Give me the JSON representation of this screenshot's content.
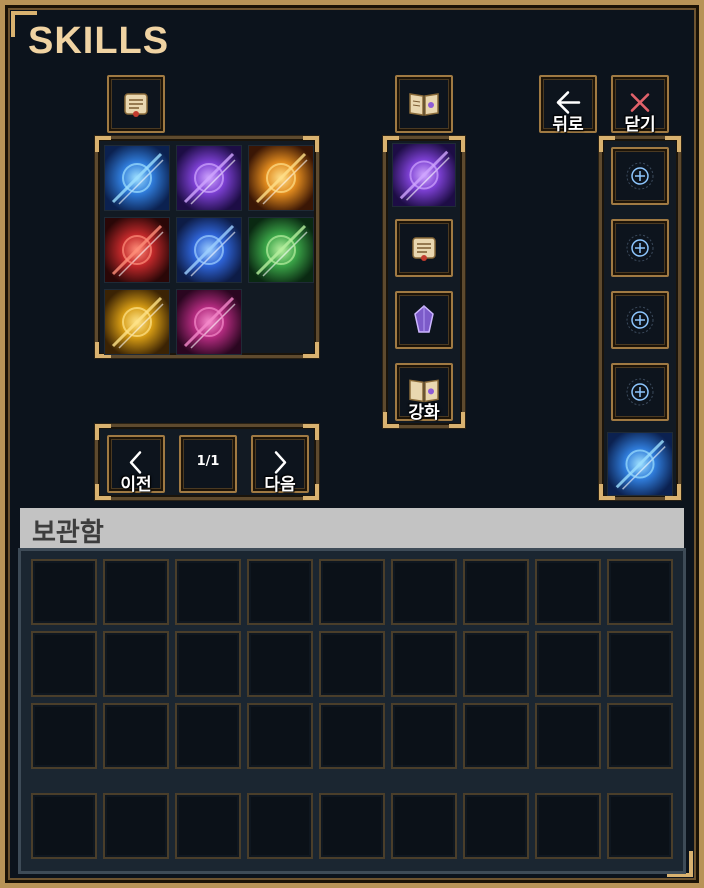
{
  "title": "SKILLS",
  "nav": {
    "back_label": "뒤로",
    "close_label": "닫기"
  },
  "enhance": {
    "enhance_label": "강화"
  },
  "pager": {
    "prev_label": "이전",
    "page_indicator": "1/1",
    "next_label": "다음"
  },
  "skills": [
    {
      "name": "blue-slash-skill-icon",
      "palette": [
        "#2f7bd9",
        "#9ee0ff",
        "#0b2150"
      ]
    },
    {
      "name": "purple-vortex-skill-icon",
      "palette": [
        "#7b3fd1",
        "#d0a6ff",
        "#1d0d45"
      ]
    },
    {
      "name": "golden-beast-skill-icon",
      "palette": [
        "#e08a1e",
        "#ffe08a",
        "#3a1605"
      ]
    },
    {
      "name": "red-fist-skill-icon",
      "palette": [
        "#c0282a",
        "#ff8f7a",
        "#2a0707"
      ]
    },
    {
      "name": "blue-shield-skill-icon",
      "palette": [
        "#2e63d6",
        "#9fd0ff",
        "#0d1c46"
      ]
    },
    {
      "name": "green-banner-skill-icon",
      "palette": [
        "#3aa347",
        "#b8f0a0",
        "#0a2912"
      ]
    },
    {
      "name": "golden-warrior-skill-icon",
      "palette": [
        "#d49a14",
        "#ffe48a",
        "#3b2304"
      ]
    },
    {
      "name": "magenta-chains-skill-icon",
      "palette": [
        "#b02a7d",
        "#f58acb",
        "#2a0620"
      ]
    }
  ],
  "selected_skill": {
    "name": "purple-vortex-skill-icon",
    "palette": [
      "#7b3fd1",
      "#d0a6ff",
      "#1d0d45"
    ]
  },
  "equipped_last": {
    "name": "blue-slash-skill-icon",
    "palette": [
      "#2f7bd9",
      "#9ee0ff",
      "#0b2150"
    ]
  },
  "storage": {
    "title": "보관함",
    "rows": 4,
    "cols": 9
  },
  "colors": {
    "gold": "#d9b270",
    "title": "#f0d3a2",
    "plus": "#8ec7ff"
  }
}
